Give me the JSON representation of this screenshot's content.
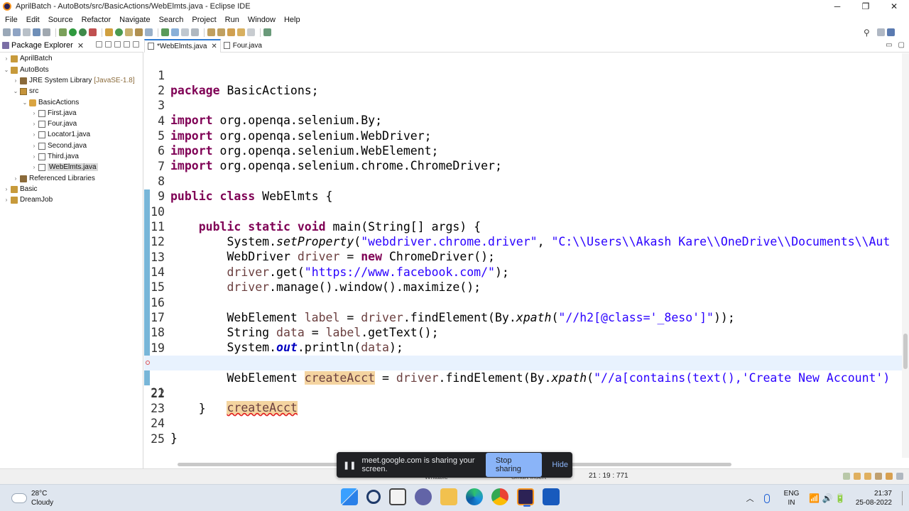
{
  "window": {
    "title": "AprilBatch - AutoBots/src/BasicActions/WebElmts.java - Eclipse IDE",
    "minimize": "─",
    "maximize": "❐",
    "close": "✕"
  },
  "menu": [
    "File",
    "Edit",
    "Source",
    "Refactor",
    "Navigate",
    "Search",
    "Project",
    "Run",
    "Window",
    "Help"
  ],
  "package_explorer": {
    "tab_label": "Package Explorer",
    "tab_close": "✕",
    "tree": [
      {
        "label": "AprilBatch",
        "icon": "project-icon",
        "arrow": "›"
      },
      {
        "label": "AutoBots",
        "icon": "project-icon",
        "arrow": "⌄"
      },
      {
        "label": "JRE System Library",
        "suffix": "[JavaSE-1.8]",
        "icon": "library-icon",
        "arrow": "›"
      },
      {
        "label": "src",
        "icon": "source-folder-icon",
        "arrow": "⌄"
      },
      {
        "label": "BasicActions",
        "icon": "package-icon",
        "arrow": "⌄"
      },
      {
        "label": "First.java",
        "icon": "java-file-icon",
        "arrow": "›"
      },
      {
        "label": "Four.java",
        "icon": "java-file-icon",
        "arrow": "›"
      },
      {
        "label": "Locator1.java",
        "icon": "java-file-icon",
        "arrow": "›"
      },
      {
        "label": "Second.java",
        "icon": "java-file-icon",
        "arrow": "›"
      },
      {
        "label": "Third.java",
        "icon": "java-file-icon",
        "arrow": "›"
      },
      {
        "label": "WebElmts.java",
        "icon": "java-file-icon",
        "arrow": "›",
        "selected": true
      },
      {
        "label": "Referenced Libraries",
        "icon": "library-icon",
        "arrow": "›"
      },
      {
        "label": "Basic",
        "icon": "project-icon",
        "arrow": "›"
      },
      {
        "label": "DreamJob",
        "icon": "project-icon",
        "arrow": "›"
      }
    ]
  },
  "editor": {
    "tabs": [
      {
        "label": "*WebElmts.java",
        "close": "✕",
        "active": true
      },
      {
        "label": "Four.java",
        "active": false
      }
    ],
    "line_numbers": [
      "1",
      "2",
      "3",
      "4",
      "5",
      "6",
      "7",
      "8",
      "9",
      "10",
      "11",
      "12",
      "13",
      "14",
      "15",
      "16",
      "17",
      "18",
      "19",
      "20",
      "21",
      "22",
      "23",
      "24",
      "25"
    ],
    "current_line": 21,
    "error_line": 21
  },
  "code": {
    "l1": [
      "package",
      " BasicActions;"
    ],
    "l3": [
      "import",
      " org.openqa.selenium.By;"
    ],
    "l4": [
      "import",
      " org.openqa.selenium.WebDriver;"
    ],
    "l5": [
      "import",
      " org.openqa.selenium.WebElement;"
    ],
    "l6": [
      "import",
      " org.openqa.selenium.chrome.ChromeDriver;"
    ],
    "l8": [
      "public class",
      " WebElmts {"
    ],
    "l10": [
      "    ",
      "public static void",
      " main(String[] args) {"
    ],
    "l11": [
      "        System.",
      "setProperty",
      "(",
      "\"webdriver.chrome.driver\"",
      ", ",
      "\"C:\\\\Users\\\\Akash Kare\\\\OneDrive\\\\Documents\\\\Aut"
    ],
    "l12": [
      "        WebDriver ",
      "driver",
      " = ",
      "new",
      " ChromeDriver();"
    ],
    "l13": [
      "        ",
      "driver",
      ".get(",
      "\"https://www.facebook.com/\"",
      ");"
    ],
    "l14": [
      "        ",
      "driver",
      ".manage().window().maximize();"
    ],
    "l16": [
      "        WebElement ",
      "label",
      " = ",
      "driver",
      ".findElement(By.",
      "xpath",
      "(",
      "\"//h2[@class='_8eso']\"",
      "));"
    ],
    "l17": [
      "        String ",
      "data",
      " = ",
      "label",
      ".getText();"
    ],
    "l18": [
      "        System.",
      "out",
      ".println(",
      "data",
      ");"
    ],
    "l20": [
      "        WebElement ",
      "createAcct",
      " = ",
      "driver",
      ".findElement(By.",
      "xpath",
      "(",
      "\"//a[contains(text(),'Create New Account')"
    ],
    "l21": [
      "        ",
      "createAcct"
    ],
    "l22": [
      "    }"
    ],
    "l24": [
      "}"
    ]
  },
  "statusbar": {
    "writable": "Writable",
    "insert_mode": "Smart Insert",
    "position": "21 : 19 : 771"
  },
  "share_banner": {
    "pause_icon": "❚❚",
    "message": "meet.google.com is sharing your screen.",
    "stop_label": "Stop sharing",
    "hide_label": "Hide"
  },
  "taskbar": {
    "weather_temp": "28°C",
    "weather_desc": "Cloudy",
    "tray_chevron": "︿",
    "lang_top": "ENG",
    "lang_bottom": "IN",
    "sys_icons": "📶 🔊 🔋",
    "time": "21:37",
    "date": "25-08-2022",
    "apps": [
      "windows-start-icon",
      "search-icon",
      "task-view-icon",
      "teams-chat-icon",
      "file-explorer-icon",
      "edge-icon",
      "chrome-icon",
      "eclipse-icon",
      "word-icon"
    ]
  },
  "colors": {
    "keyword": "#7f0055",
    "string": "#2a00ff",
    "field": "#0000c0",
    "local_var": "#6a3e3e",
    "occurrence_highlight": "#f4d4a0",
    "current_line": "#e8f2fe",
    "share_banner_bg": "#202124",
    "share_stop_bg": "#8ab4f8"
  }
}
